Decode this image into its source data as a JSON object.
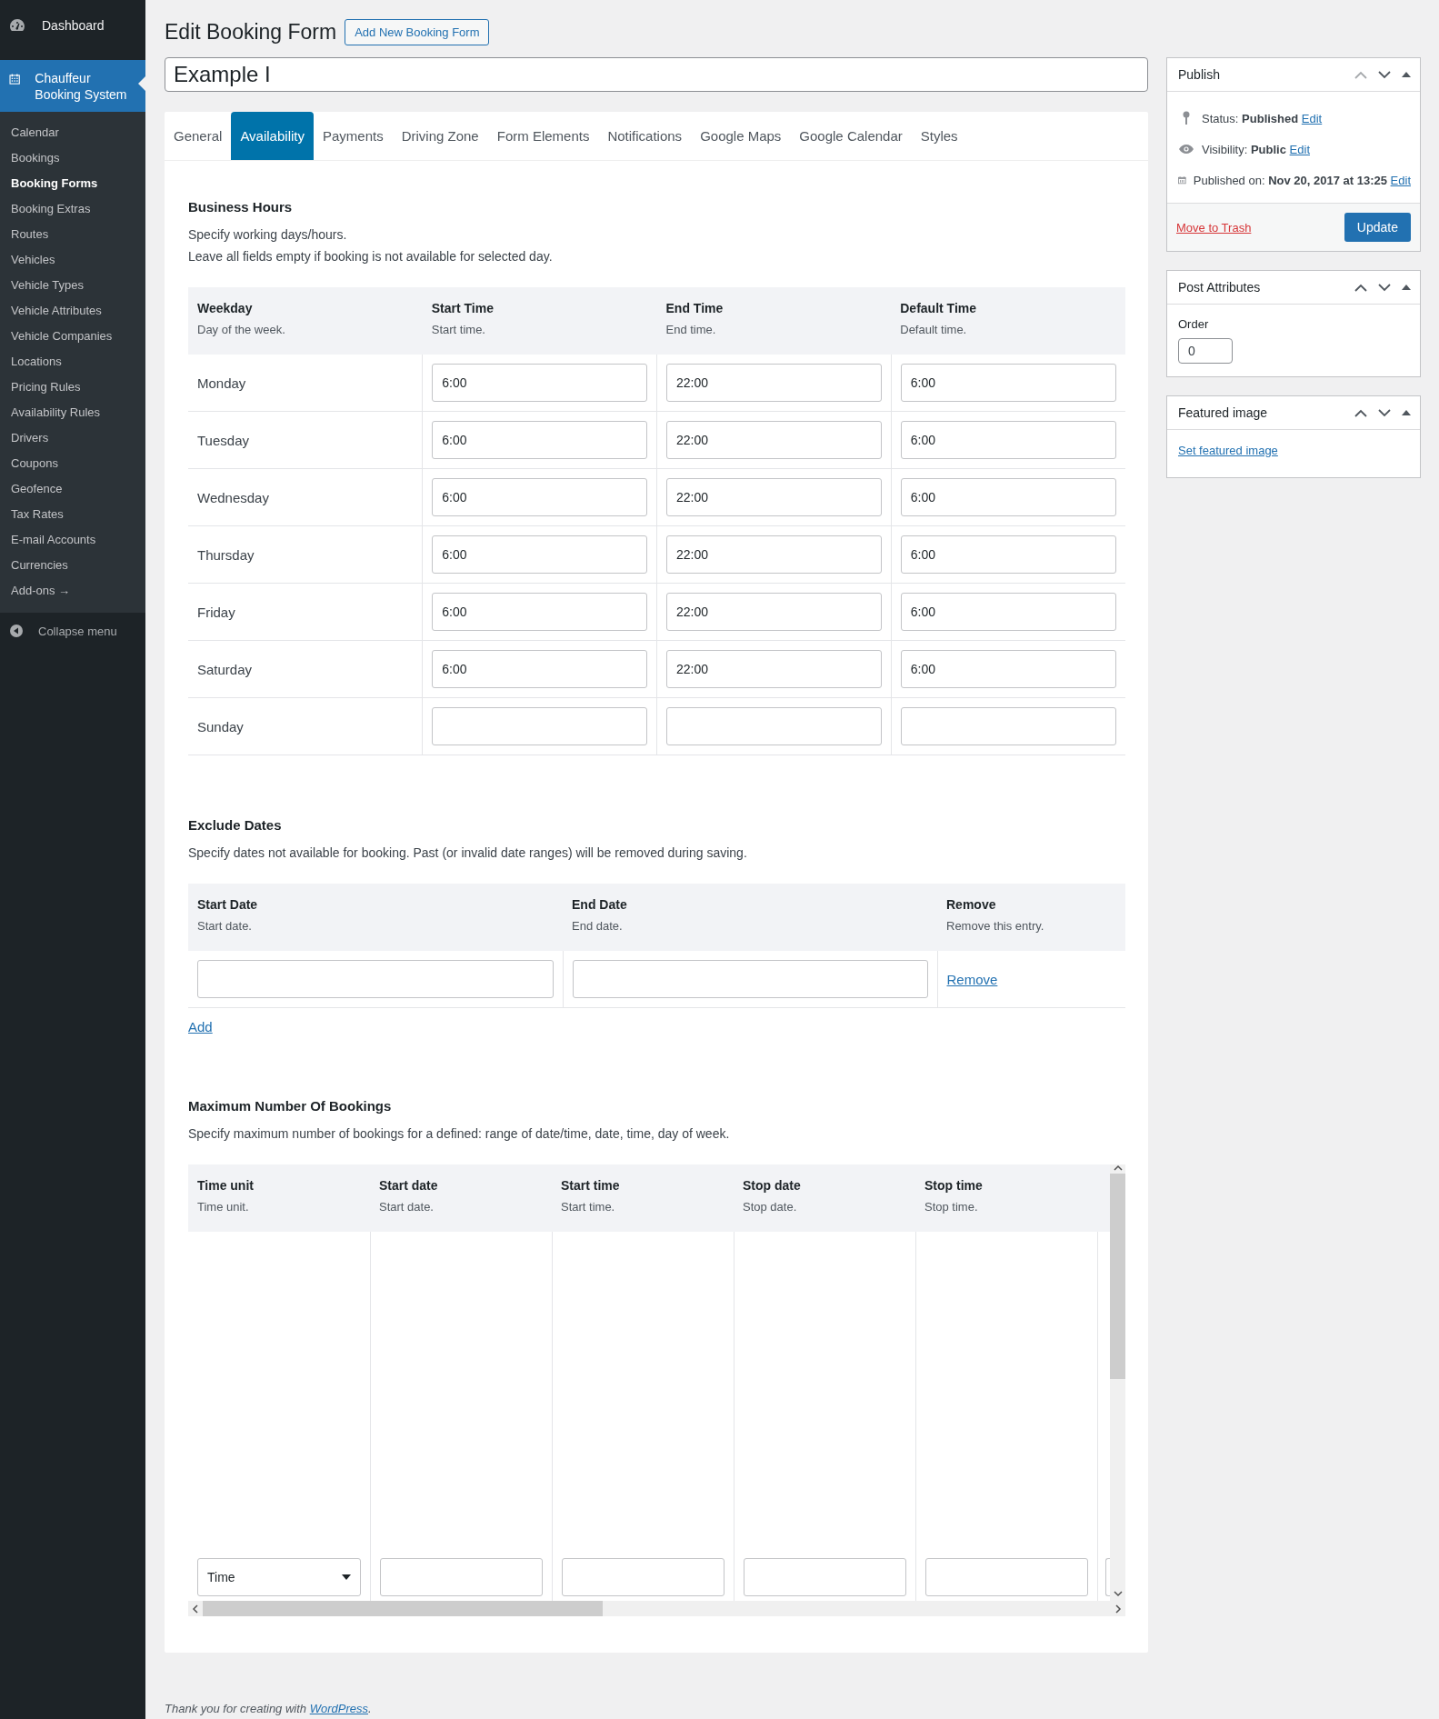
{
  "sidebar": {
    "dashboard": "Dashboard",
    "plugin": "Chauffeur Booking System",
    "items": [
      {
        "label": "Calendar",
        "selected": false
      },
      {
        "label": "Bookings",
        "selected": false
      },
      {
        "label": "Booking Forms",
        "selected": true
      },
      {
        "label": "Booking Extras",
        "selected": false
      },
      {
        "label": "Routes",
        "selected": false
      },
      {
        "label": "Vehicles",
        "selected": false
      },
      {
        "label": "Vehicle Types",
        "selected": false
      },
      {
        "label": "Vehicle Attributes",
        "selected": false
      },
      {
        "label": "Vehicle Companies",
        "selected": false
      },
      {
        "label": "Locations",
        "selected": false
      },
      {
        "label": "Pricing Rules",
        "selected": false
      },
      {
        "label": "Availability Rules",
        "selected": false
      },
      {
        "label": "Drivers",
        "selected": false
      },
      {
        "label": "Coupons",
        "selected": false
      },
      {
        "label": "Geofence",
        "selected": false
      },
      {
        "label": "Tax Rates",
        "selected": false
      },
      {
        "label": "E-mail Accounts",
        "selected": false
      },
      {
        "label": "Currencies",
        "selected": false
      },
      {
        "label": "Add-ons →",
        "selected": false
      }
    ],
    "collapse": "Collapse menu"
  },
  "page": {
    "title": "Edit Booking Form",
    "add_button": "Add New Booking Form",
    "post_title": "Example I"
  },
  "tabs": [
    {
      "label": "General",
      "selected": false
    },
    {
      "label": "Availability",
      "selected": true
    },
    {
      "label": "Payments",
      "selected": false
    },
    {
      "label": "Driving Zone",
      "selected": false
    },
    {
      "label": "Form Elements",
      "selected": false
    },
    {
      "label": "Notifications",
      "selected": false
    },
    {
      "label": "Google Maps",
      "selected": false
    },
    {
      "label": "Google Calendar",
      "selected": false
    },
    {
      "label": "Styles",
      "selected": false
    }
  ],
  "business_hours": {
    "title": "Business Hours",
    "description": [
      "Specify working days/hours.",
      "Leave all fields empty if booking is not available for selected day."
    ],
    "columns": [
      {
        "label": "Weekday",
        "hint": "Day of the week."
      },
      {
        "label": "Start Time",
        "hint": "Start time."
      },
      {
        "label": "End Time",
        "hint": "End time."
      },
      {
        "label": "Default Time",
        "hint": "Default time."
      }
    ],
    "rows": [
      {
        "day": "Monday",
        "start": "6:00",
        "end": "22:00",
        "default": "6:00"
      },
      {
        "day": "Tuesday",
        "start": "6:00",
        "end": "22:00",
        "default": "6:00"
      },
      {
        "day": "Wednesday",
        "start": "6:00",
        "end": "22:00",
        "default": "6:00"
      },
      {
        "day": "Thursday",
        "start": "6:00",
        "end": "22:00",
        "default": "6:00"
      },
      {
        "day": "Friday",
        "start": "6:00",
        "end": "22:00",
        "default": "6:00"
      },
      {
        "day": "Saturday",
        "start": "6:00",
        "end": "22:00",
        "default": "6:00"
      },
      {
        "day": "Sunday"
      }
    ]
  },
  "exclude_dates": {
    "title": "Exclude Dates",
    "description": "Specify dates not available for booking. Past (or invalid date ranges) will be removed during saving.",
    "columns": [
      {
        "label": "Start Date",
        "hint": "Start date."
      },
      {
        "label": "End Date",
        "hint": "End date."
      },
      {
        "label": "Remove",
        "hint": "Remove this entry."
      }
    ],
    "rows": [
      {
        "remove": "Remove"
      }
    ],
    "add": "Add"
  },
  "max_bookings": {
    "title": "Maximum Number Of Bookings",
    "description": "Specify maximum number of bookings for a defined: range of date/time, date, time, day of week.",
    "columns": [
      {
        "label": "Time unit",
        "hint": "Time unit."
      },
      {
        "label": "Start date",
        "hint": "Start date."
      },
      {
        "label": "Start time",
        "hint": "Start time."
      },
      {
        "label": "Stop date",
        "hint": "Stop date."
      },
      {
        "label": "Stop time",
        "hint": "Stop time."
      }
    ],
    "rows": [
      {
        "time_unit": "Time"
      }
    ]
  },
  "publish": {
    "title": "Publish",
    "lines": [
      {
        "kind": "status",
        "text": "Status: **Published**",
        "link": "Edit"
      },
      {
        "kind": "visibility",
        "text": "Visibility: **Public**",
        "link": "Edit"
      },
      {
        "kind": "date",
        "text": "Published on: **Nov 20, 2017 at 13:25**",
        "link": "Edit"
      }
    ],
    "trash": "Move to Trash",
    "update": "Update"
  },
  "post_attributes": {
    "title": "Post Attributes",
    "order_label": "Order",
    "order": "0"
  },
  "featured_image": {
    "title": "Featured image",
    "link": "Set featured image"
  },
  "footer": {
    "text": "Thank you for creating with",
    "link": "WordPress",
    "suffix": "."
  }
}
